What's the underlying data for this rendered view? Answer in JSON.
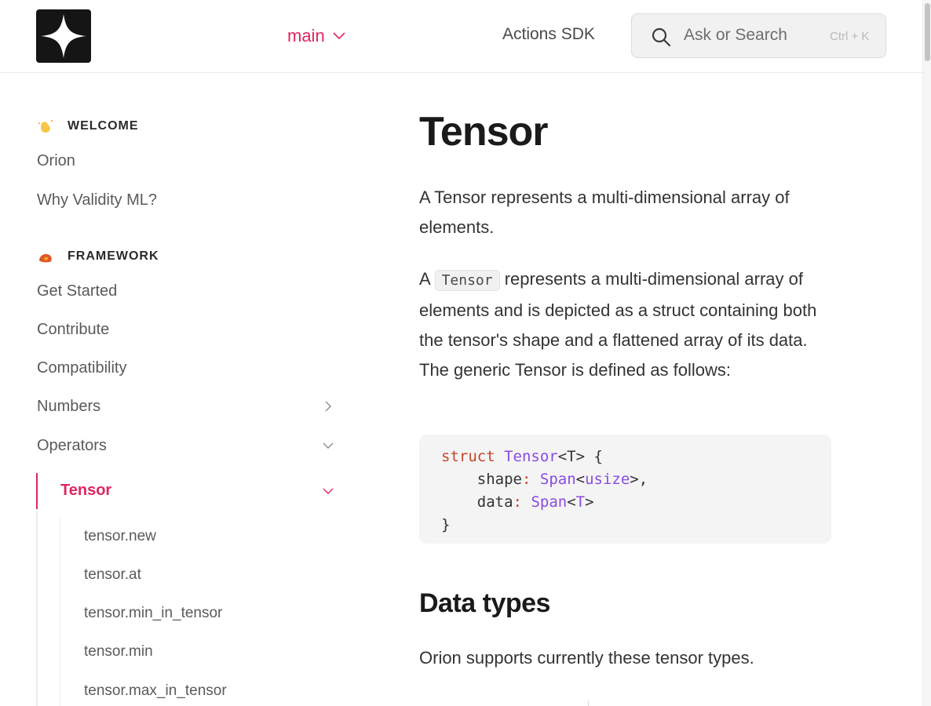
{
  "header": {
    "version_label": "main",
    "nav_link": "Actions SDK",
    "search_placeholder": "Ask or Search",
    "search_shortcut": "Ctrl + K"
  },
  "sidebar": {
    "sections": [
      {
        "title": "WELCOME",
        "items": [
          "Orion",
          "Why Validity ML?"
        ]
      },
      {
        "title": "FRAMEWORK",
        "items": [
          "Get Started",
          "Contribute",
          "Compatibility",
          "Numbers",
          "Operators"
        ]
      }
    ],
    "active_item": "Tensor",
    "sub_items": [
      "tensor.new",
      "tensor.at",
      "tensor.min_in_tensor",
      "tensor.min",
      "tensor.max_in_tensor"
    ]
  },
  "content": {
    "title": "Tensor",
    "lead": "A Tensor represents a multi-dimensional array of elements.",
    "p2_prefix": "A ",
    "p2_code": "Tensor",
    "p2_rest": " represents a multi-dimensional array of elements and is depicted as a struct containing both the tensor's shape and a flattened array of its data. The generic Tensor is defined as follows:",
    "code": {
      "line1_kw": "struct",
      "line1_ty": "Tensor",
      "line1_rest": "<T> {",
      "line2_field": "shape",
      "line2_type": "Span",
      "line2_generic": "usize",
      "line3_field": "data",
      "line3_type": "Span",
      "line3_generic": "T",
      "line4": "}"
    },
    "h2": "Data types",
    "p3": "Orion supports currently these tensor types."
  },
  "colors": {
    "accent": "#e0265f",
    "keyword": "#c4452b",
    "type": "#8a4be0"
  }
}
